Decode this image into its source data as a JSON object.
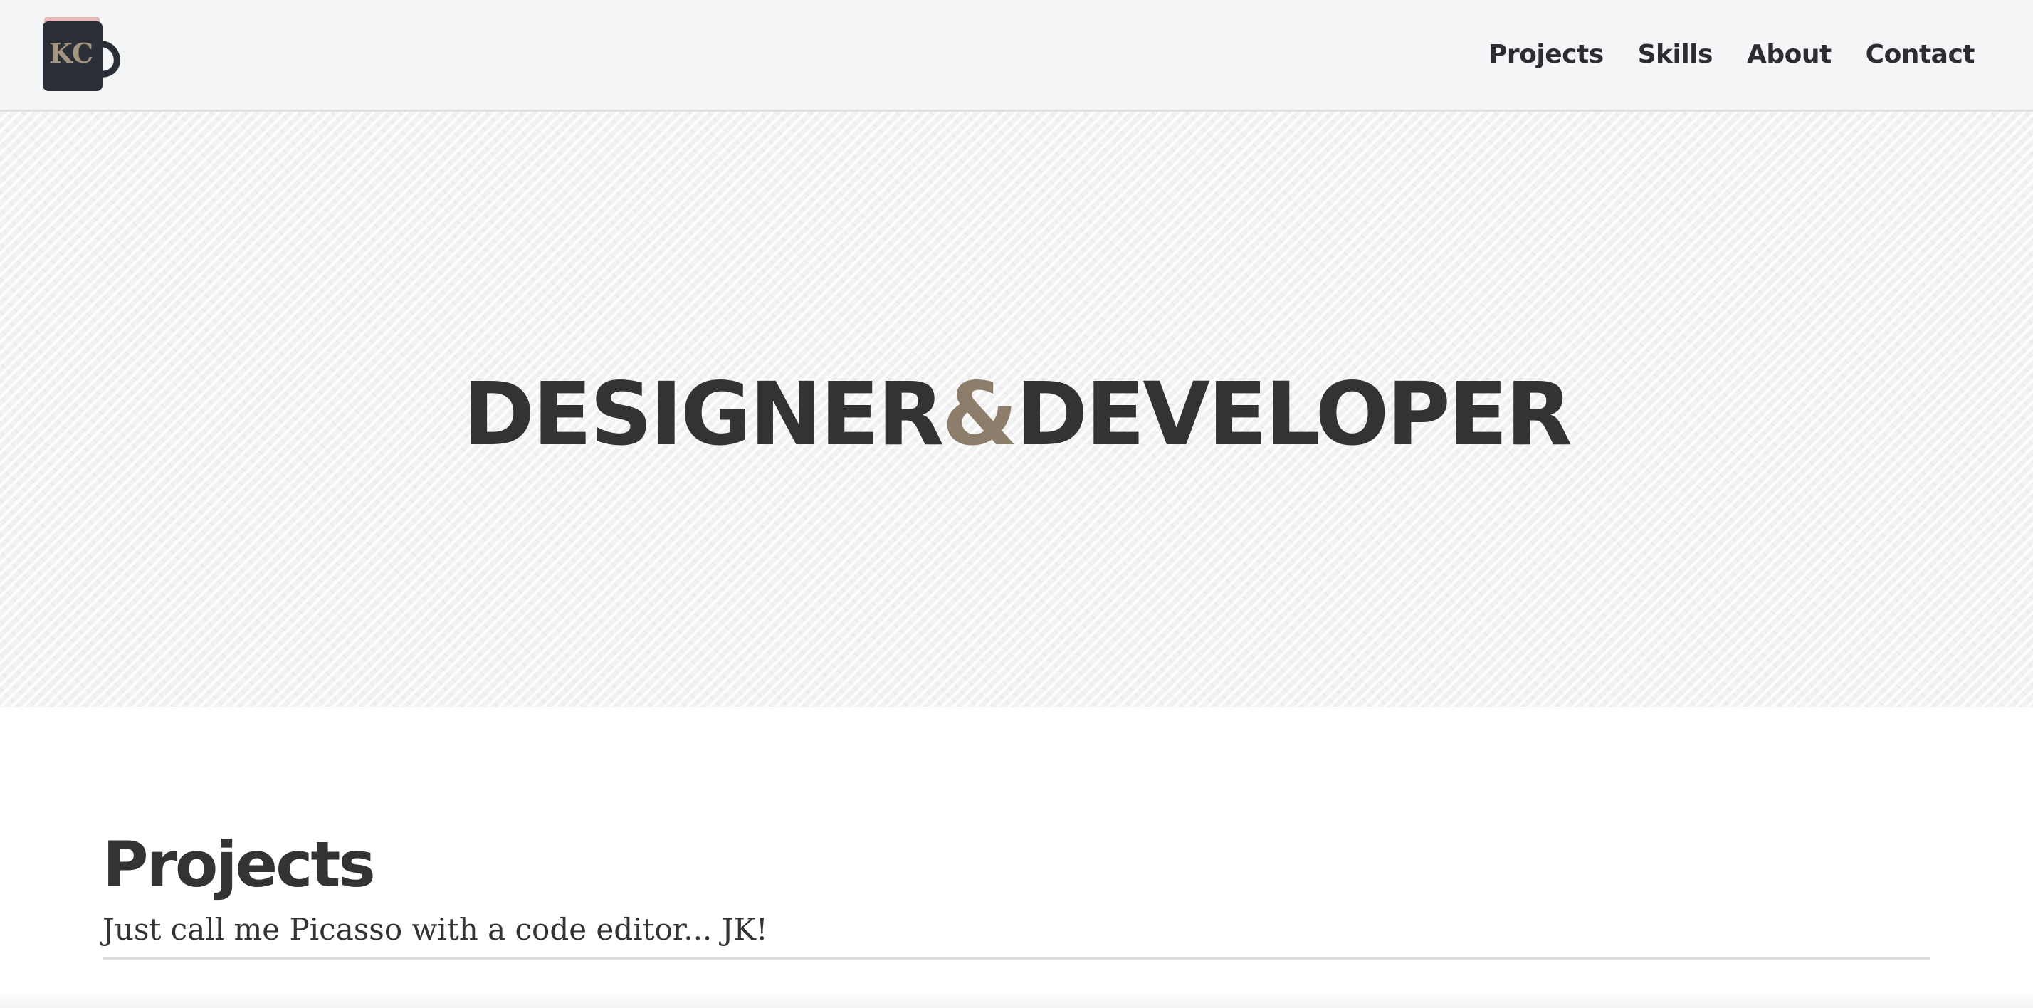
{
  "header": {
    "logo": {
      "text": "KC",
      "icon": "mug-icon"
    },
    "nav": [
      {
        "label": "Projects"
      },
      {
        "label": "Skills"
      },
      {
        "label": "About"
      },
      {
        "label": "Contact"
      }
    ]
  },
  "hero": {
    "word_left": "DESIGNER",
    "ampersand": "&",
    "word_right": "DEVELOPER"
  },
  "projects": {
    "title": "Projects",
    "subtitle": "Just call me Picasso with a code editor... JK!"
  },
  "colors": {
    "text_dark": "#333333",
    "accent": "#8c7e6a",
    "navbar_bg": "#f4f5f7",
    "logo_bg": "#2b3038"
  }
}
